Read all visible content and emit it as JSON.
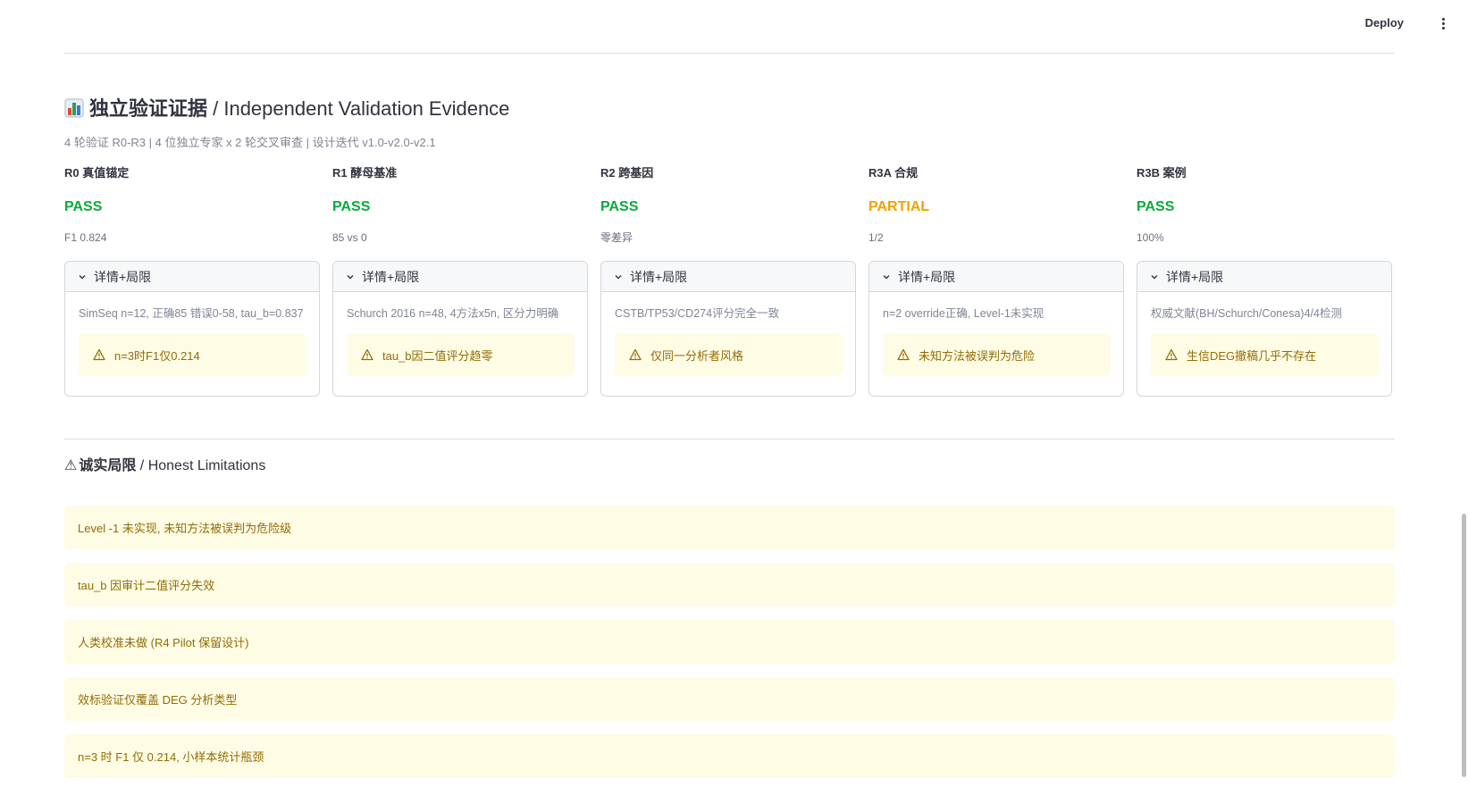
{
  "header": {
    "deploy_label": "Deploy",
    "menu_icon": "kebab-menu-icon"
  },
  "validation": {
    "title_icon": "bar-chart-icon",
    "title_zh": "独立验证证据",
    "title_en": " / Independent Validation Evidence",
    "caption": "4 轮验证 R0-R3 | 4 位独立专家 x 2 轮交叉审查 | 设计迭代 v1.0-v2.0-v2.1",
    "expander_label": "详情+局限",
    "rounds": [
      {
        "label": "R0 真值锚定",
        "status": "PASS",
        "status_color": "#09ab3b",
        "value": "F1 0.824",
        "detail": "SimSeq n=12, 正确85 错误0-58, tau_b=0.837",
        "warning": "n=3时F1仅0.214"
      },
      {
        "label": "R1 酵母基准",
        "status": "PASS",
        "status_color": "#09ab3b",
        "value": "85 vs 0",
        "detail": "Schurch 2016 n=48, 4方法x5n, 区分力明确",
        "warning": "tau_b因二值评分趋零"
      },
      {
        "label": "R2 跨基因",
        "status": "PASS",
        "status_color": "#09ab3b",
        "value": "零差异",
        "detail": "CSTB/TP53/CD274评分完全一致",
        "warning": "仅同一分析者风格"
      },
      {
        "label": "R3A 合规",
        "status": "PARTIAL",
        "status_color": "#f4a100",
        "value": "1/2",
        "detail": "n=2 override正确, Level-1未实现",
        "warning": "未知方法被误判为危险"
      },
      {
        "label": "R3B 案例",
        "status": "PASS",
        "status_color": "#09ab3b",
        "value": "100%",
        "detail": "权威文献(BH/Schurch/Conesa)4/4检测",
        "warning": "生信DEG撤稿几乎不存在"
      }
    ]
  },
  "limitations": {
    "title_icon": "⚠",
    "title_zh": "诚实局限",
    "title_en": " / Honest Limitations",
    "items": [
      "Level -1 未实现, 未知方法被误判为危险级",
      "tau_b 因审计二值评分失效",
      "人类校准未做 (R4 Pilot 保留设计)",
      "效标验证仅覆盖 DEG 分析类型",
      "n=3 时 F1 仅 0.214, 小样本统计瓶颈"
    ]
  }
}
